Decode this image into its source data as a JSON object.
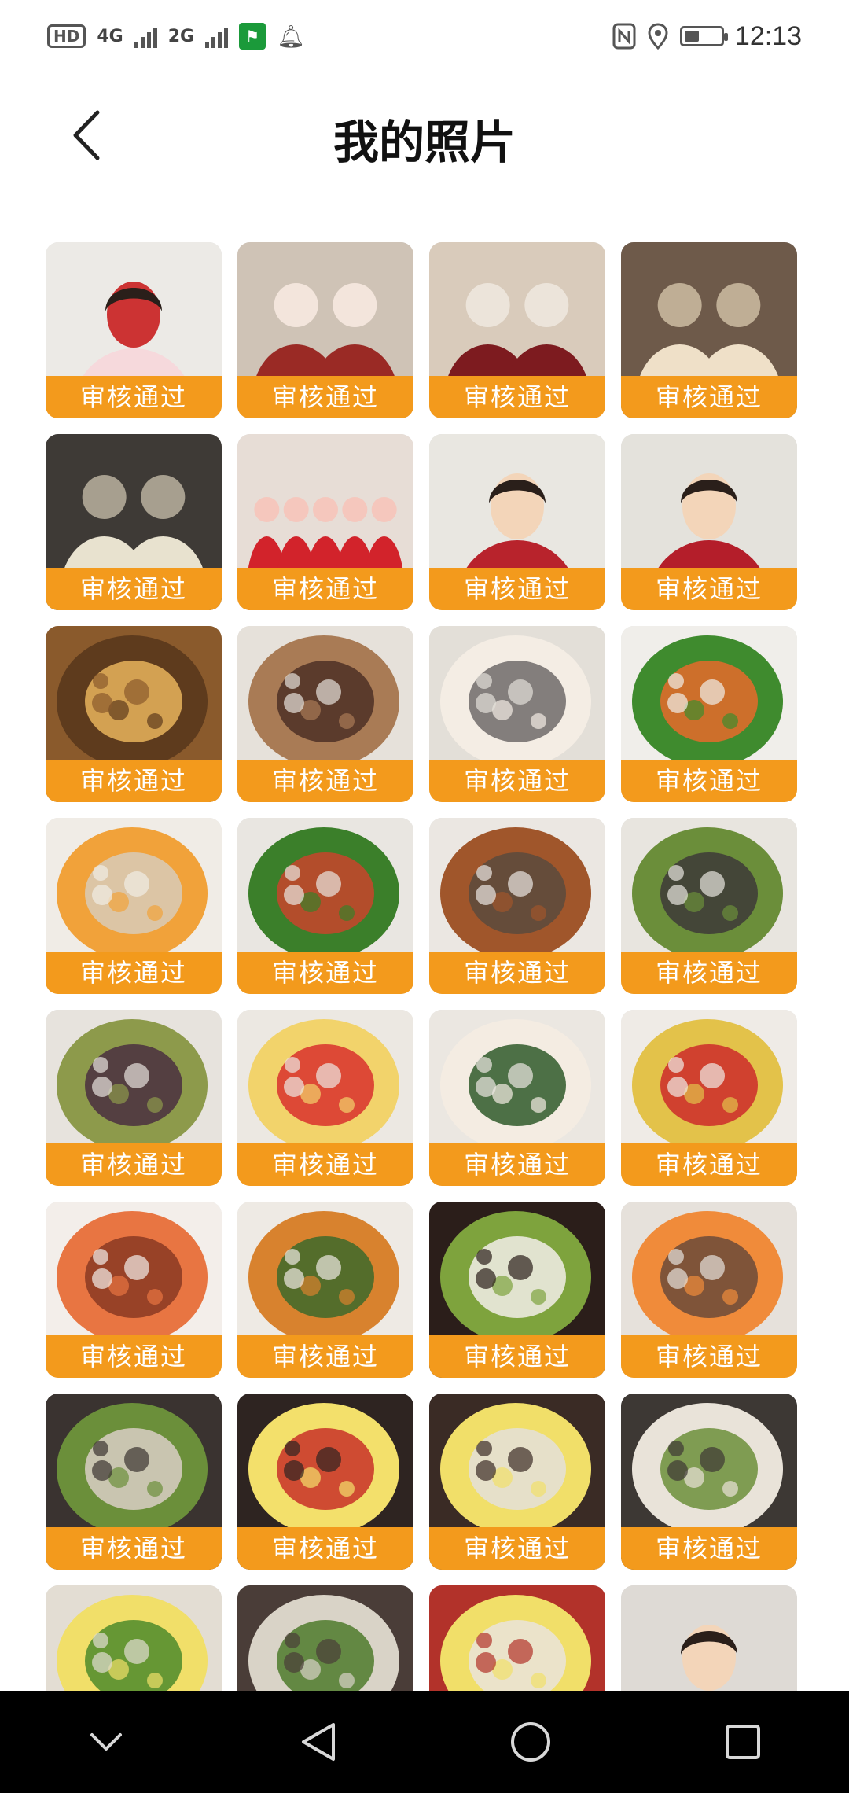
{
  "status_bar": {
    "hd": "HD",
    "net1": "4G",
    "net2": "2G",
    "time": "12:13"
  },
  "header": {
    "title": "我的照片"
  },
  "photos": [
    {
      "status": "审核通过",
      "kind": "portrait",
      "colors": [
        "#eceae6",
        "#f6d9dc",
        "#c33"
      ]
    },
    {
      "status": "审核通过",
      "kind": "people",
      "colors": [
        "#cfc3b6",
        "#9a2a25",
        "#f3e5dc"
      ]
    },
    {
      "status": "审核通过",
      "kind": "people",
      "colors": [
        "#d9cbbb",
        "#7d1b1f",
        "#ece4da"
      ]
    },
    {
      "status": "审核通过",
      "kind": "people",
      "colors": [
        "#6e5a4a",
        "#efe0c8",
        "#bfae95"
      ]
    },
    {
      "status": "审核通过",
      "kind": "people",
      "colors": [
        "#3e3a36",
        "#e8e2cf",
        "#a79f8f"
      ]
    },
    {
      "status": "审核通过",
      "kind": "group",
      "colors": [
        "#e7ddd6",
        "#d2232b",
        "#f5c7bd"
      ]
    },
    {
      "status": "审核通过",
      "kind": "portrait",
      "colors": [
        "#e9e7e1",
        "#b8232c",
        "#f3d5b9"
      ]
    },
    {
      "status": "审核通过",
      "kind": "portrait",
      "colors": [
        "#e4e2dc",
        "#b41e2a",
        "#f3d5b9"
      ]
    },
    {
      "status": "审核通过",
      "kind": "food",
      "colors": [
        "#8a5a2c",
        "#5e3b1d",
        "#e7b45c"
      ]
    },
    {
      "status": "审核通过",
      "kind": "food",
      "colors": [
        "#e6e1da",
        "#a97b55",
        "#4d3026"
      ]
    },
    {
      "status": "审核通过",
      "kind": "food",
      "colors": [
        "#e3dfd8",
        "#f4ede4",
        "#6f6a6a"
      ]
    },
    {
      "status": "审核通过",
      "kind": "food",
      "colors": [
        "#f0eeea",
        "#3f8b2e",
        "#e66a2a"
      ]
    },
    {
      "status": "审核通过",
      "kind": "food",
      "colors": [
        "#f0ece6",
        "#f1a23a",
        "#d8cbb9"
      ]
    },
    {
      "status": "审核通过",
      "kind": "food",
      "colors": [
        "#e9e6e1",
        "#3b7f2a",
        "#c9442c"
      ]
    },
    {
      "status": "审核通过",
      "kind": "food",
      "colors": [
        "#ebe7e2",
        "#a0562b",
        "#5b4a3d"
      ]
    },
    {
      "status": "审核通过",
      "kind": "food",
      "colors": [
        "#e8e5df",
        "#6b8e3a",
        "#3d3a38"
      ]
    },
    {
      "status": "审核通过",
      "kind": "food",
      "colors": [
        "#e7e3dd",
        "#8d9a4b",
        "#4a2f3f"
      ]
    },
    {
      "status": "审核通过",
      "kind": "food",
      "colors": [
        "#ece8e2",
        "#f2d36b",
        "#d9302d"
      ]
    },
    {
      "status": "审核通过",
      "kind": "food",
      "colors": [
        "#ebe7e1",
        "#f4ece2",
        "#2f5a2a"
      ]
    },
    {
      "status": "审核通过",
      "kind": "food",
      "colors": [
        "#efebe6",
        "#e3c24a",
        "#cc2a2a"
      ]
    },
    {
      "status": "审核通过",
      "kind": "food",
      "colors": [
        "#f3eeea",
        "#e87542",
        "#8a3a22"
      ]
    },
    {
      "status": "审核通过",
      "kind": "food",
      "colors": [
        "#eeeae4",
        "#d8822e",
        "#3d6a2a"
      ]
    },
    {
      "status": "审核通过",
      "kind": "food",
      "colors": [
        "#2b1e1a",
        "#7ea33d",
        "#f2efe9"
      ]
    },
    {
      "status": "审核通过",
      "kind": "food",
      "colors": [
        "#e6e1db",
        "#f08b3a",
        "#6b4a3a"
      ]
    },
    {
      "status": "审核通过",
      "kind": "food",
      "colors": [
        "#3a3330",
        "#6b8f3a",
        "#d9cfc5"
      ]
    },
    {
      "status": "审核通过",
      "kind": "food",
      "colors": [
        "#2e2421",
        "#f3e06b",
        "#c83028"
      ]
    },
    {
      "status": "审核通过",
      "kind": "food",
      "colors": [
        "#3a2b25",
        "#f1df69",
        "#e4e0da"
      ]
    },
    {
      "status": "审核通过",
      "kind": "food",
      "colors": [
        "#3d3834",
        "#e9e3d9",
        "#6c8f3a"
      ]
    },
    {
      "status": "",
      "kind": "food",
      "colors": [
        "#e3ddd3",
        "#f1df69",
        "#4e8b2c"
      ]
    },
    {
      "status": "",
      "kind": "food",
      "colors": [
        "#4a3d38",
        "#d9d3c7",
        "#4e7a2c"
      ]
    },
    {
      "status": "",
      "kind": "food",
      "colors": [
        "#b2322a",
        "#f1df69",
        "#eae4dc"
      ]
    },
    {
      "status": "",
      "kind": "portrait",
      "colors": [
        "#dedad5",
        "#d3232b",
        "#f3d5b9"
      ]
    }
  ],
  "nav": {
    "icons": [
      "chevron-down",
      "back-triangle",
      "home-circle",
      "recents-square"
    ]
  }
}
